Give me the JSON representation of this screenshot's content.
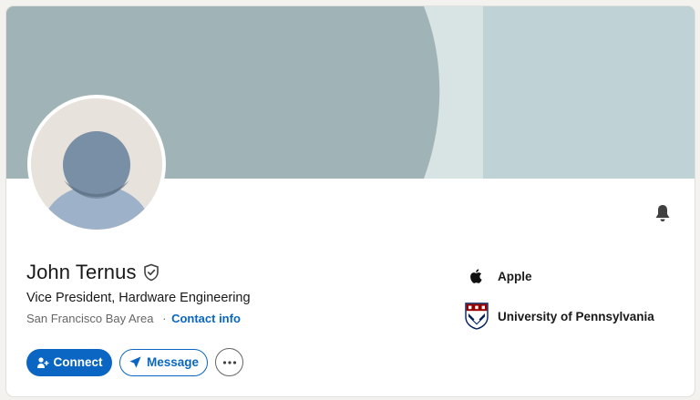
{
  "profile": {
    "name": "John Ternus",
    "headline": "Vice President, Hardware Engineering",
    "location": "San Francisco Bay Area",
    "separator": "·",
    "contact_info_label": "Contact info"
  },
  "actions": {
    "connect_label": "Connect",
    "message_label": "Message",
    "more_icon": "ellipsis-icon"
  },
  "organizations": [
    {
      "name": "Apple",
      "logo": "apple-logo"
    },
    {
      "name": "University of Pennsylvania",
      "logo": "upenn-shield-logo"
    }
  ],
  "icons": {
    "notification": "bell-icon",
    "verified": "verified-shield-icon",
    "connect": "add-person-icon",
    "message": "send-icon"
  },
  "colors": {
    "accent": "#0a66c2",
    "banner_dark": "#a0b4b7",
    "banner_light": "#bfd2d6",
    "banner_mid": "#d8e3e4"
  }
}
